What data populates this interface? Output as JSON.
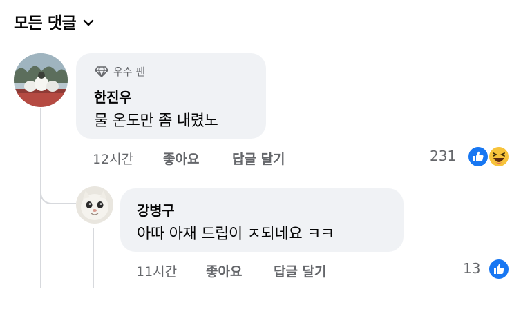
{
  "header": {
    "title": "모든 댓글"
  },
  "comments": [
    {
      "badge": "우수 팬",
      "author": "한진우",
      "text": "물 온도만 좀 내렸노",
      "time": "12시간",
      "like_label": "좋아요",
      "reply_label": "답글 달기",
      "reaction_count": "231",
      "reactions": [
        "like-icon",
        "haha-icon"
      ]
    },
    {
      "author": "강병구",
      "text": "아따 아재 드립이 ㅈ되네요 ㅋㅋ",
      "time": "11시간",
      "like_label": "좋아요",
      "reply_label": "답글 달기",
      "reaction_count": "13",
      "reactions": [
        "like-icon"
      ]
    }
  ],
  "colors": {
    "bubble": "#f0f2f5",
    "meta_text": "#65676b",
    "like_blue": "#1877f2",
    "haha_yellow": "#f7c33b",
    "thread_line": "#d7d9dd"
  }
}
